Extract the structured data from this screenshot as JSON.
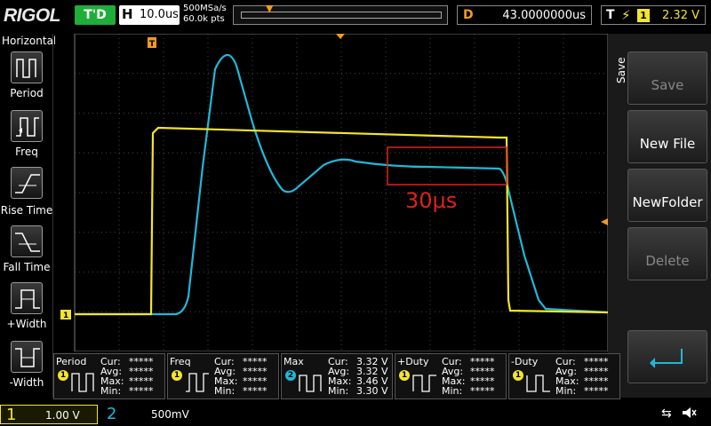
{
  "topbar": {
    "logo": "RIGOL",
    "run_state": "T'D",
    "horizontal_letter": "H",
    "timebase": "10.0us",
    "sample_rate": "500MSa/s",
    "memory_depth": "60.0k pts",
    "delay_letter": "D",
    "delay_value": "43.0000000us",
    "trigger_letter": "T",
    "trigger_channel": "1",
    "trigger_level": "2.32 V"
  },
  "left_panel": {
    "title": "Horizontal",
    "items": [
      {
        "label": "Period",
        "icon": "period-icon"
      },
      {
        "label": "Freq",
        "icon": "freq-icon"
      },
      {
        "label": "Rise Time",
        "icon": "rise-time-icon"
      },
      {
        "label": "Fall Time",
        "icon": "fall-time-icon"
      },
      {
        "label": "+Width",
        "icon": "positive-width-icon"
      },
      {
        "label": "-Width",
        "icon": "negative-width-icon"
      }
    ]
  },
  "right_panel": {
    "title": "Save",
    "buttons": [
      {
        "label": "Save",
        "enabled": false
      },
      {
        "label": "New File",
        "enabled": true
      },
      {
        "label": "NewFolder",
        "enabled": true
      },
      {
        "label": "Delete",
        "enabled": false
      }
    ],
    "enter_icon": "return-arrow-icon"
  },
  "annotation": {
    "text": "30μs",
    "color": "#e02020"
  },
  "markers": {
    "ch1": "1",
    "trigger_position": "T"
  },
  "measurements": [
    {
      "name": "Period",
      "channel": "1",
      "rows": [
        [
          "Cur:",
          "*****"
        ],
        [
          "Avg:",
          "*****"
        ],
        [
          "Max:",
          "*****"
        ],
        [
          "Min:",
          "*****"
        ]
      ]
    },
    {
      "name": "Freq",
      "channel": "1",
      "rows": [
        [
          "Cur:",
          "*****"
        ],
        [
          "Avg:",
          "*****"
        ],
        [
          "Max:",
          "*****"
        ],
        [
          "Min:",
          "*****"
        ]
      ]
    },
    {
      "name": "Max",
      "channel": "2",
      "rows": [
        [
          "Cur:",
          "3.32 V"
        ],
        [
          "Avg:",
          "3.32 V"
        ],
        [
          "Max:",
          "3.46 V"
        ],
        [
          "Min:",
          "3.30 V"
        ]
      ]
    },
    {
      "name": "+Duty",
      "channel": "1",
      "rows": [
        [
          "Cur:",
          "*****"
        ],
        [
          "Avg:",
          "*****"
        ],
        [
          "Max:",
          "*****"
        ],
        [
          "Min:",
          "*****"
        ]
      ]
    },
    {
      "name": "-Duty",
      "channel": "1",
      "rows": [
        [
          "Cur:",
          "*****"
        ],
        [
          "Avg:",
          "*****"
        ],
        [
          "Max:",
          "*****"
        ],
        [
          "Min:",
          "*****"
        ]
      ]
    }
  ],
  "channels": [
    {
      "num": "1",
      "scale": "1.00 V",
      "color": "#f4e52a"
    },
    {
      "num": "2",
      "scale": "500mV",
      "color": "#20b8d8"
    }
  ],
  "colors": {
    "ch1": "#f4e52a",
    "ch2": "#20b8d8",
    "trigger": "#f39a1e",
    "run_state": "#1fae3a"
  }
}
